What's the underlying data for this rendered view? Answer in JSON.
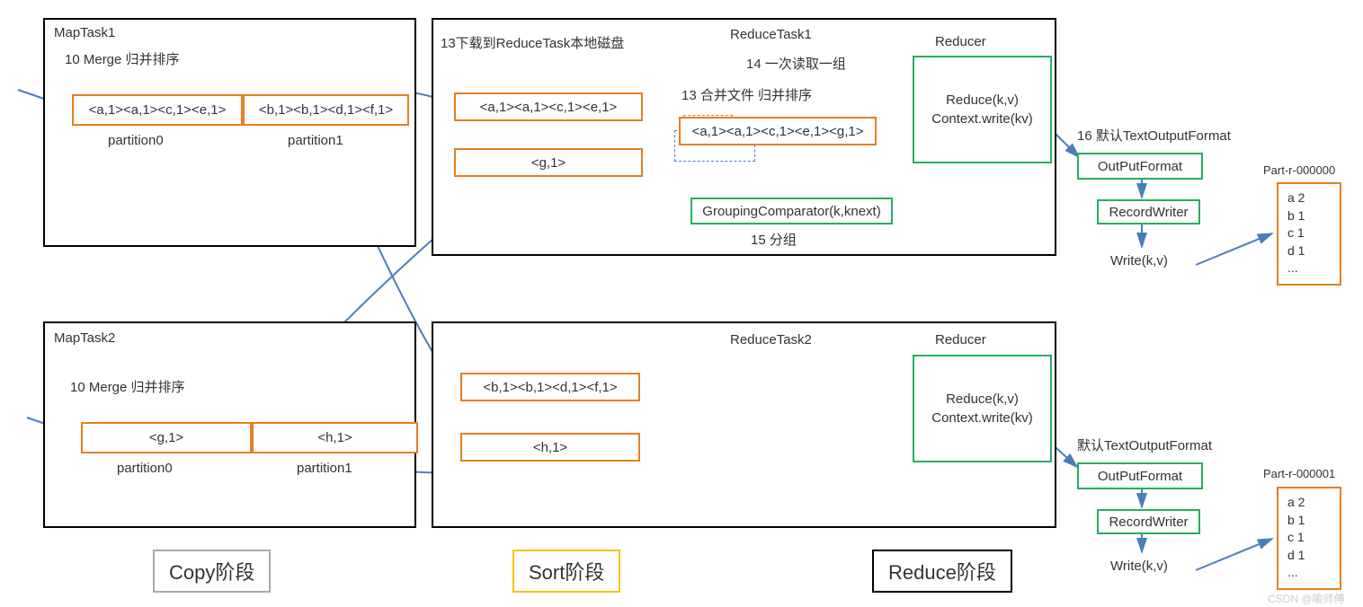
{
  "mapTask1": {
    "title": "MapTask1",
    "mergeLabel": "10 Merge 归并排序",
    "p0": "<a,1><a,1><c,1><e,1>",
    "p1": "<b,1><b,1><d,1><f,1>",
    "p0Label": "partition0",
    "p1Label": "partition1"
  },
  "mapTask2": {
    "title": "MapTask2",
    "mergeLabel": "10 Merge 归并排序",
    "p0": "<g,1>",
    "p1": "<h,1>",
    "p0Label": "partition0",
    "p1Label": "partition1"
  },
  "reduceTask1": {
    "title": "ReduceTask1",
    "downloadLabel": "13下载到ReduceTask本地磁盘",
    "readLabel": "14 一次读取一组",
    "mergeSortLabel": "13 合并文件 归并排序",
    "groupLabel": "15 分组",
    "copied1": "<a,1><a,1><c,1><e,1>",
    "copied2": "<g,1>",
    "merged": "<a,1><a,1><c,1><e,1><g,1>",
    "grouping": "GroupingComparator(k,knext)",
    "reducerTitle": "Reducer",
    "reduceLine1": "Reduce(k,v)",
    "reduceLine2": "Context.write(kv)",
    "defaultFormatLabel": "16 默认TextOutputFormat",
    "outputFormat": "OutPutFormat",
    "recordWriter": "RecordWriter",
    "writeLabel": "Write(k,v)",
    "partFile": "Part-r-000000",
    "fileLines": [
      "a 2",
      "b 1",
      "c 1",
      "d 1",
      "..."
    ]
  },
  "reduceTask2": {
    "title": "ReduceTask2",
    "copied1": "<b,1><b,1><d,1><f,1>",
    "copied2": "<h,1>",
    "reducerTitle": "Reducer",
    "reduceLine1": "Reduce(k,v)",
    "reduceLine2": "Context.write(kv)",
    "defaultFormatLabel": "默认TextOutputFormat",
    "outputFormat": "OutPutFormat",
    "recordWriter": "RecordWriter",
    "writeLabel": "Write(k,v)",
    "partFile": "Part-r-000001",
    "fileLines": [
      "a 2",
      "b 1",
      "c 1",
      "d 1",
      "..."
    ]
  },
  "phases": {
    "copy": "Copy阶段",
    "sort": "Sort阶段",
    "reduce": "Reduce阶段"
  },
  "watermark": "CSDN @喻师傅"
}
